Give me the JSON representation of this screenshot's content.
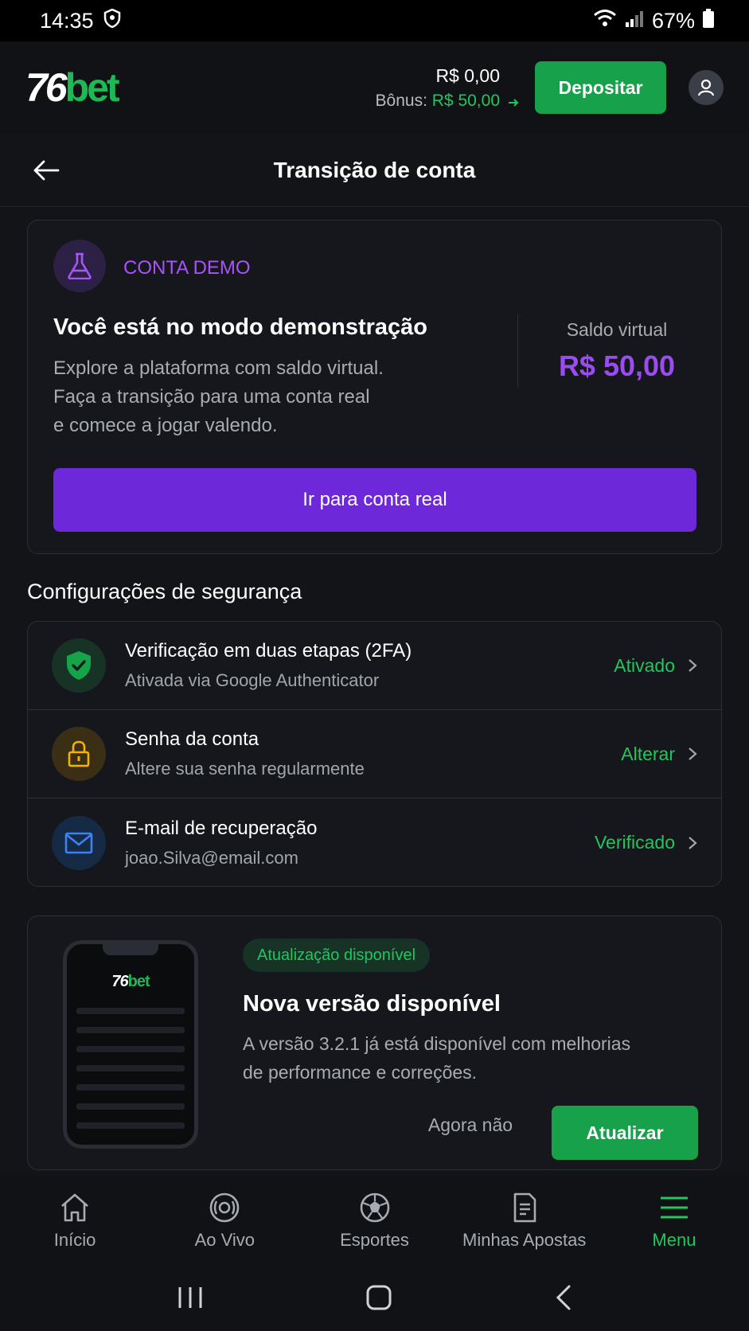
{
  "status_bar": {
    "time": "14:35",
    "battery": "67%"
  },
  "header": {
    "logo_number": "76",
    "logo_word": "bet",
    "balance": "R$ 0,00",
    "bonus_label": "Bônus:",
    "bonus_value": "R$ 50,00",
    "deposit_label": "Depositar"
  },
  "page": {
    "title": "Transição de conta"
  },
  "demo": {
    "badge": "CONTA DEMO",
    "title": "Você está no modo demonstração",
    "description_lines": [
      "Explore a plataforma com saldo virtual.",
      "Faça a transição para uma conta real",
      "e comece a jogar valendo."
    ],
    "saldo_label": "Saldo virtual",
    "saldo_value": "R$ 50,00",
    "button": "Ir para conta real"
  },
  "security": {
    "heading": "Configurações de segurança",
    "items": [
      {
        "title": "Verificação em duas etapas (2FA)",
        "subtitle": "Ativada via Google Authenticator",
        "status": "Ativado",
        "icon": "shield-check-icon"
      },
      {
        "title": "Senha da conta",
        "subtitle": "Altere sua senha regularmente",
        "status": "Alterar",
        "icon": "lock-icon"
      },
      {
        "title": "E-mail de recuperação",
        "subtitle": "joao.Silva@email.com",
        "status": "Verificado",
        "icon": "mail-icon"
      }
    ]
  },
  "update": {
    "pill": "Atualização disponível",
    "title": "Nova versão disponível",
    "description_lines": [
      "A versão 3.2.1 já está disponível com melhorias",
      "de performance e correções."
    ],
    "later": "Agora não",
    "update": "Atualizar"
  },
  "bottom_nav": [
    {
      "label": "Início",
      "icon": "home-icon",
      "active": false
    },
    {
      "label": "Ao Vivo",
      "icon": "live-icon",
      "active": false
    },
    {
      "label": "Esportes",
      "icon": "soccer-ball-icon",
      "active": false
    },
    {
      "label": "Minhas Apostas",
      "icon": "bets-document-icon",
      "active": false
    },
    {
      "label": "Menu",
      "icon": "menu-icon",
      "active": true
    }
  ],
  "colors": {
    "accent_green": "#22c55e",
    "accent_purple": "#6d28d9",
    "background": "#121418"
  }
}
